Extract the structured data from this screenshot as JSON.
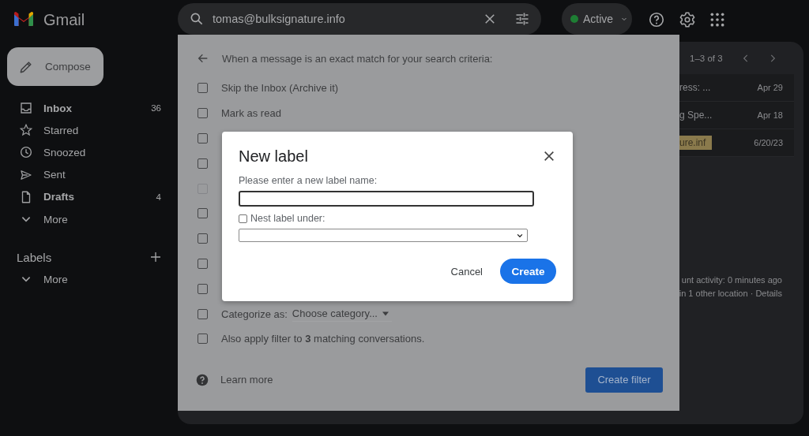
{
  "app": {
    "name": "Gmail"
  },
  "search": {
    "value": "tomas@bulksignature.info"
  },
  "status": {
    "label": "Active",
    "online": true
  },
  "compose": {
    "label": "Compose"
  },
  "nav": [
    {
      "kind": "inbox",
      "label": "Inbox",
      "count": "36",
      "unread": true
    },
    {
      "kind": "star",
      "label": "Starred",
      "unread": false
    },
    {
      "kind": "clock",
      "label": "Snoozed",
      "unread": false
    },
    {
      "kind": "send",
      "label": "Sent",
      "unread": false
    },
    {
      "kind": "file",
      "label": "Drafts",
      "count": "4",
      "unread": true
    },
    {
      "kind": "more",
      "label": "More",
      "unread": false
    }
  ],
  "labels": {
    "title": "Labels",
    "items": [
      {
        "kind": "more",
        "label": "More"
      }
    ]
  },
  "mail": {
    "range": "1–3 of 3",
    "rows": [
      {
        "snippet": "ress: ...",
        "date": "Apr 29",
        "highlight": false
      },
      {
        "snippet": "g Spe...",
        "date": "Apr 18",
        "highlight": false
      },
      {
        "snippet": "ure.inf",
        "date": "6/20/23",
        "highlight": true
      }
    ],
    "activity": "unt activity: 0 minutes ago",
    "location": "in 1 other location · ",
    "link": "Details"
  },
  "filter": {
    "heading": "When a message is an exact match for your search criteria:",
    "options": [
      {
        "kind": "check",
        "label": "Skip the Inbox (Archive it)",
        "checked": false,
        "disabled": false
      },
      {
        "kind": "check",
        "label": "Mark as read",
        "checked": false,
        "disabled": false
      },
      {
        "kind": "check",
        "checked": false,
        "disabled": false
      },
      {
        "kind": "check",
        "checked": false,
        "disabled": false
      },
      {
        "kind": "check",
        "checked": false,
        "disabled": true
      },
      {
        "kind": "check",
        "checked": false,
        "disabled": false
      },
      {
        "kind": "check",
        "checked": false,
        "disabled": false
      },
      {
        "kind": "check",
        "checked": false,
        "disabled": false
      },
      {
        "kind": "check",
        "checked": false,
        "disabled": false
      },
      {
        "kind": "category",
        "label": "Categorize as:",
        "dropdown": "Choose category...",
        "checked": false,
        "disabled": false
      },
      {
        "kind": "check",
        "label": "Also apply filter to **3** matching conversations.",
        "checked": false,
        "disabled": false
      }
    ],
    "learn_more": "Learn more",
    "button": "Create filter"
  },
  "dialog": {
    "title": "New label",
    "prompt": "Please enter a new label name:",
    "nest": {
      "label": "Nest label under:",
      "checked": false
    },
    "cancel": "Cancel",
    "create": "Create"
  }
}
